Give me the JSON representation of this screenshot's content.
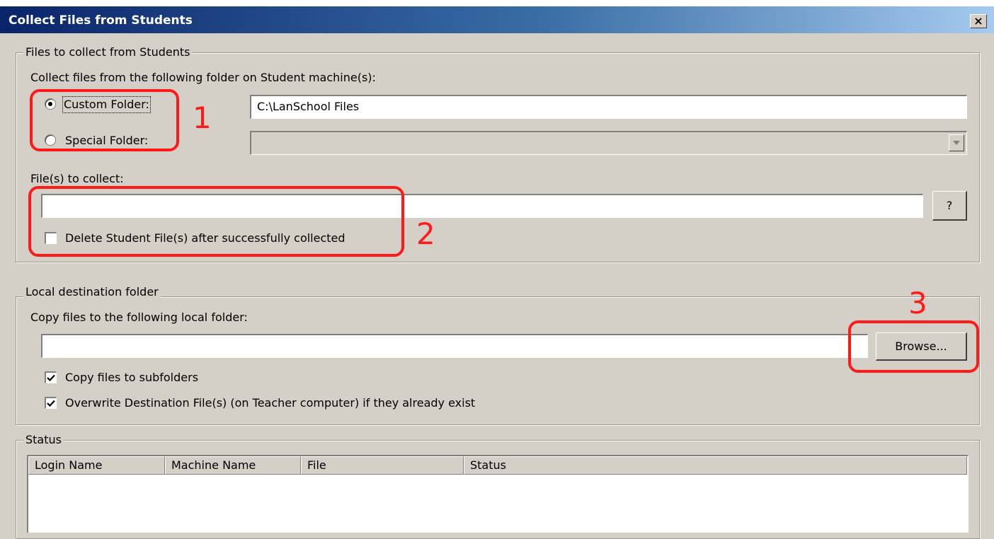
{
  "window": {
    "title": "Collect Files from Students",
    "close_glyph": "×"
  },
  "collect_group": {
    "legend": "Files to collect from Students",
    "instruction": "Collect files from the following folder on Student machine(s):",
    "custom_folder": {
      "label": "Custom Folder:",
      "selected": true
    },
    "custom_folder_path": "C:\\LanSchool Files",
    "special_folder": {
      "label": "Special Folder:",
      "selected": false
    },
    "special_folder_value": "",
    "files_label": "File(s) to collect:",
    "files_value": "",
    "help_button": "?",
    "delete_checkbox": {
      "label": "Delete Student File(s) after successfully collected",
      "checked": false
    }
  },
  "destination_group": {
    "legend": "Local destination folder",
    "instruction": "Copy files to the following local folder:",
    "folder_value": "",
    "browse_button": "Browse...",
    "copy_subfolders": {
      "label": "Copy files to subfolders",
      "checked": true
    },
    "overwrite": {
      "label": "Overwrite Destination File(s) (on Teacher computer) if they already exist",
      "checked": true
    }
  },
  "status_group": {
    "legend": "Status",
    "columns": [
      "Login Name",
      "Machine Name",
      "File",
      "Status"
    ]
  },
  "annotations": [
    "1",
    "2",
    "3"
  ],
  "colors": {
    "annotation": "#ff1a1a",
    "titlebar_start": "#0a246a",
    "titlebar_end": "#a6caf0",
    "dialog_face": "#d4d0c8"
  }
}
